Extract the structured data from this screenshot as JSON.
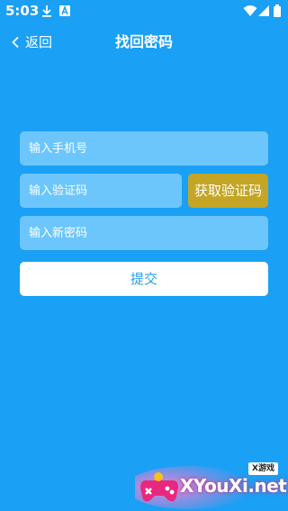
{
  "status_bar": {
    "time": "5:03",
    "icons": [
      "download-icon",
      "notification-a-icon",
      "wifi-icon",
      "signal-icon",
      "battery-icon"
    ]
  },
  "header": {
    "back_label": "返回",
    "title": "找回密码"
  },
  "form": {
    "phone_placeholder": "输入手机号",
    "code_placeholder": "输入验证码",
    "get_code_label": "获取验证码",
    "new_password_placeholder": "输入新密码",
    "submit_label": "提交"
  },
  "watermark": {
    "badge": "X游戏",
    "text": "XYouXi.net"
  },
  "colors": {
    "background": "#1aa0f4",
    "field": "#6cc6fb",
    "code_button": "#c4a526",
    "submit_button": "#ffffff",
    "submit_text": "#2a9fe8"
  }
}
